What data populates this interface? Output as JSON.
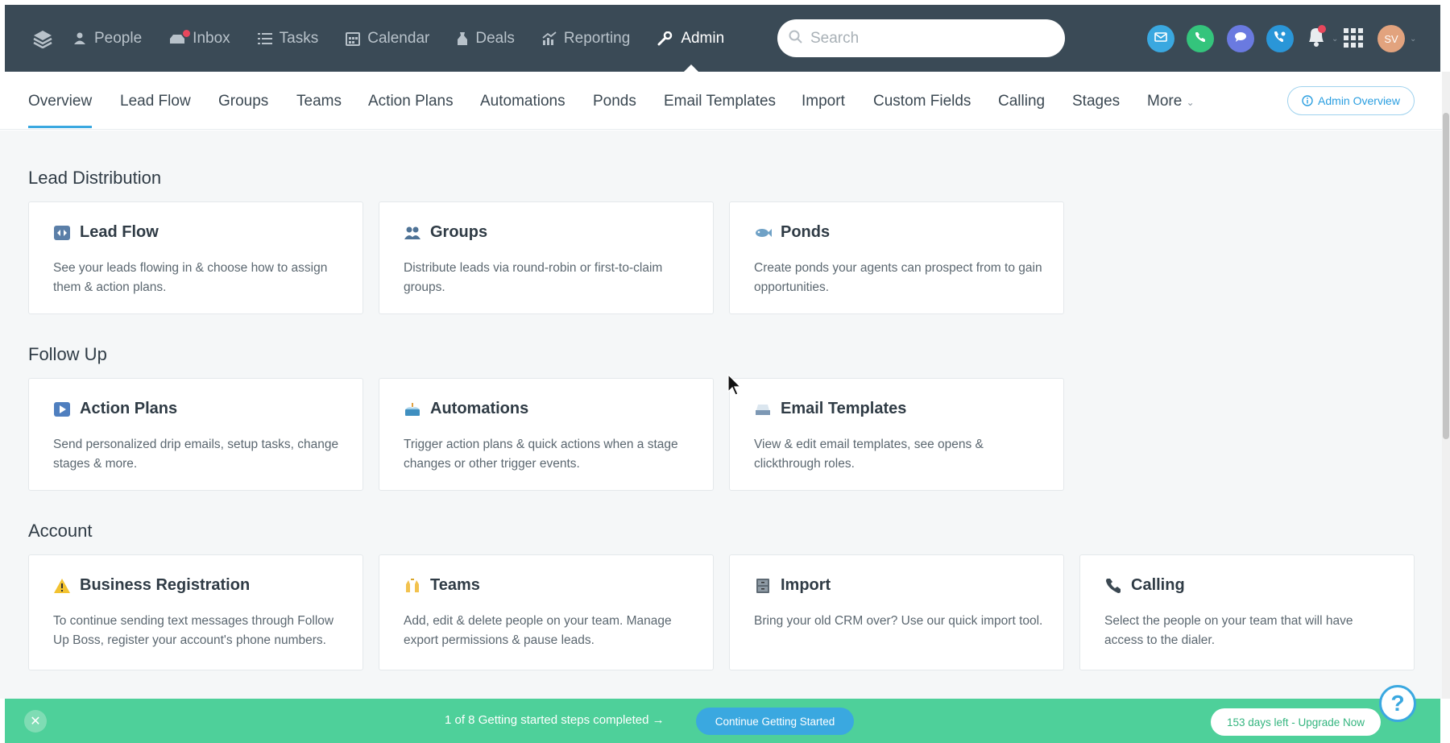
{
  "topnav": {
    "items": [
      {
        "label": "People",
        "icon": "person-icon"
      },
      {
        "label": "Inbox",
        "icon": "inbox-icon"
      },
      {
        "label": "Tasks",
        "icon": "tasks-icon"
      },
      {
        "label": "Calendar",
        "icon": "calendar-icon"
      },
      {
        "label": "Deals",
        "icon": "deals-icon"
      },
      {
        "label": "Reporting",
        "icon": "reporting-icon"
      },
      {
        "label": "Admin",
        "icon": "wrench-icon"
      }
    ],
    "search_placeholder": "Search",
    "avatar_initials": "SV",
    "colors": {
      "bar": "#3a4a56",
      "email": "#3aa8e0",
      "phone": "#34c47c",
      "chat": "#6a7ae0",
      "dialer": "#2a96d8",
      "avatar": "#e2a37e"
    }
  },
  "subnav": {
    "items": [
      "Overview",
      "Lead Flow",
      "Groups",
      "Teams",
      "Action Plans",
      "Automations",
      "Ponds",
      "Email Templates",
      "Import",
      "Custom Fields",
      "Calling",
      "Stages",
      "More"
    ],
    "admin_overview": "Admin Overview"
  },
  "sections": [
    {
      "title": "Lead Distribution",
      "cards": [
        {
          "title": "Lead Flow",
          "icon": "lead-flow-icon",
          "desc": "See your leads flowing in & choose how to assign them & action plans."
        },
        {
          "title": "Groups",
          "icon": "groups-icon",
          "desc": "Distribute leads via round-robin or first-to-claim groups."
        },
        {
          "title": "Ponds",
          "icon": "fish-icon",
          "desc": "Create ponds your agents can prospect from to gain opportunities."
        }
      ]
    },
    {
      "title": "Follow Up",
      "cards": [
        {
          "title": "Action Plans",
          "icon": "play-icon",
          "desc": "Send personalized drip emails, setup tasks, change stages & more."
        },
        {
          "title": "Automations",
          "icon": "cake-icon",
          "desc": "Trigger action plans & quick actions when a stage changes or other trigger events."
        },
        {
          "title": "Email Templates",
          "icon": "email-tray-icon",
          "desc": "View & edit email templates, see opens & clickthrough roles."
        }
      ]
    },
    {
      "title": "Account",
      "cards": [
        {
          "title": "Business Registration",
          "icon": "warning-icon",
          "desc": "To continue sending text messages through Follow Up Boss, register your account's phone numbers."
        },
        {
          "title": "Teams",
          "icon": "hands-icon",
          "desc": "Add, edit & delete people on your team. Manage export permissions & pause leads."
        },
        {
          "title": "Import",
          "icon": "cabinet-icon",
          "desc": "Bring your old CRM over? Use our quick import tool."
        },
        {
          "title": "Calling",
          "icon": "phone-icon",
          "desc": "Select the people on your team that will have access to the dialer."
        }
      ]
    }
  ],
  "bottombar": {
    "steps_text": "1 of 8 Getting started steps completed →",
    "continue_label": "Continue Getting Started",
    "upgrade_label": "153 days left - Upgrade Now",
    "help_label": "?"
  }
}
